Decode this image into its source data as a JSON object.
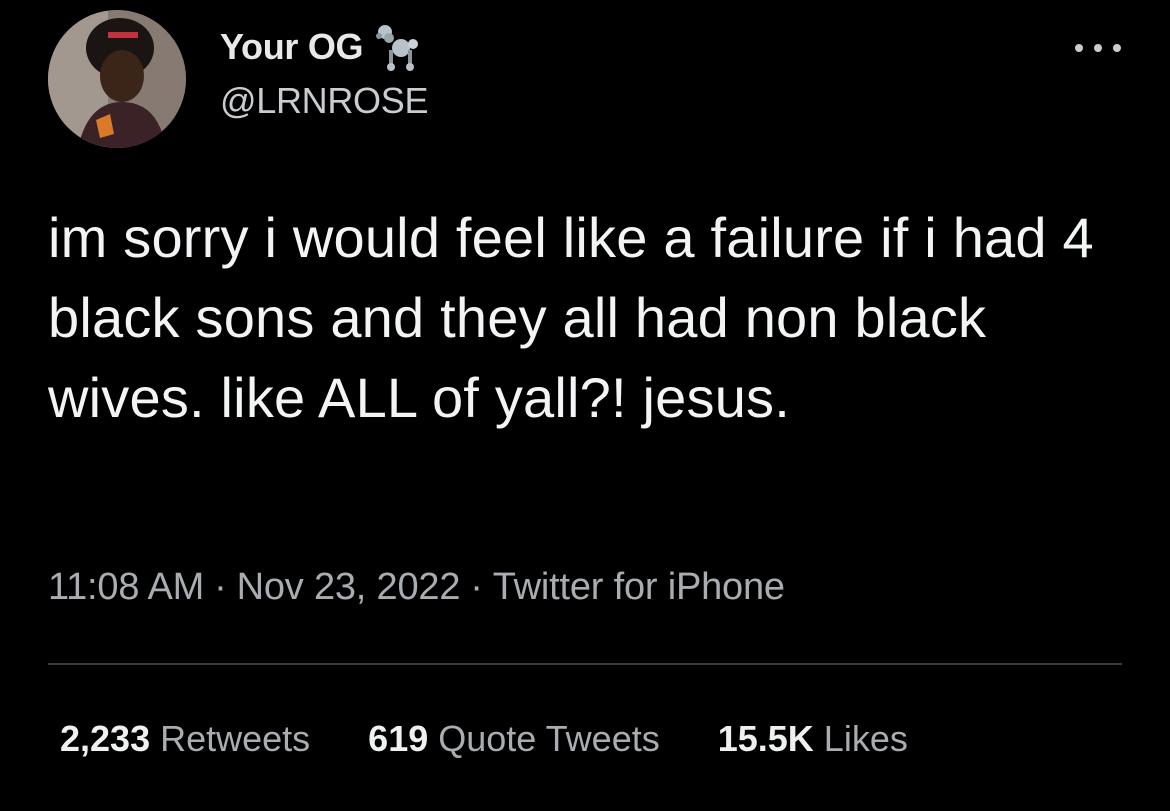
{
  "author": {
    "display_name": "Your OG",
    "name_emoji": "poodle-icon",
    "handle": "@LRNROSE"
  },
  "tweet": {
    "text": "im sorry i would feel like a failure if i had 4 black sons and they all had non black wives. like ALL of yall?! jesus.",
    "time": "11:08 AM",
    "date": "Nov 23, 2022",
    "source": "Twitter for iPhone",
    "separator": "·"
  },
  "stats": {
    "retweets_count": "2,233",
    "retweets_label": "Retweets",
    "quotes_count": "619",
    "quotes_label": "Quote Tweets",
    "likes_count": "15.5K",
    "likes_label": "Likes"
  },
  "colors": {
    "background": "#000000",
    "text_primary": "#e7e9ea",
    "text_secondary": "#a9adb1",
    "divider": "#3a3d40"
  }
}
